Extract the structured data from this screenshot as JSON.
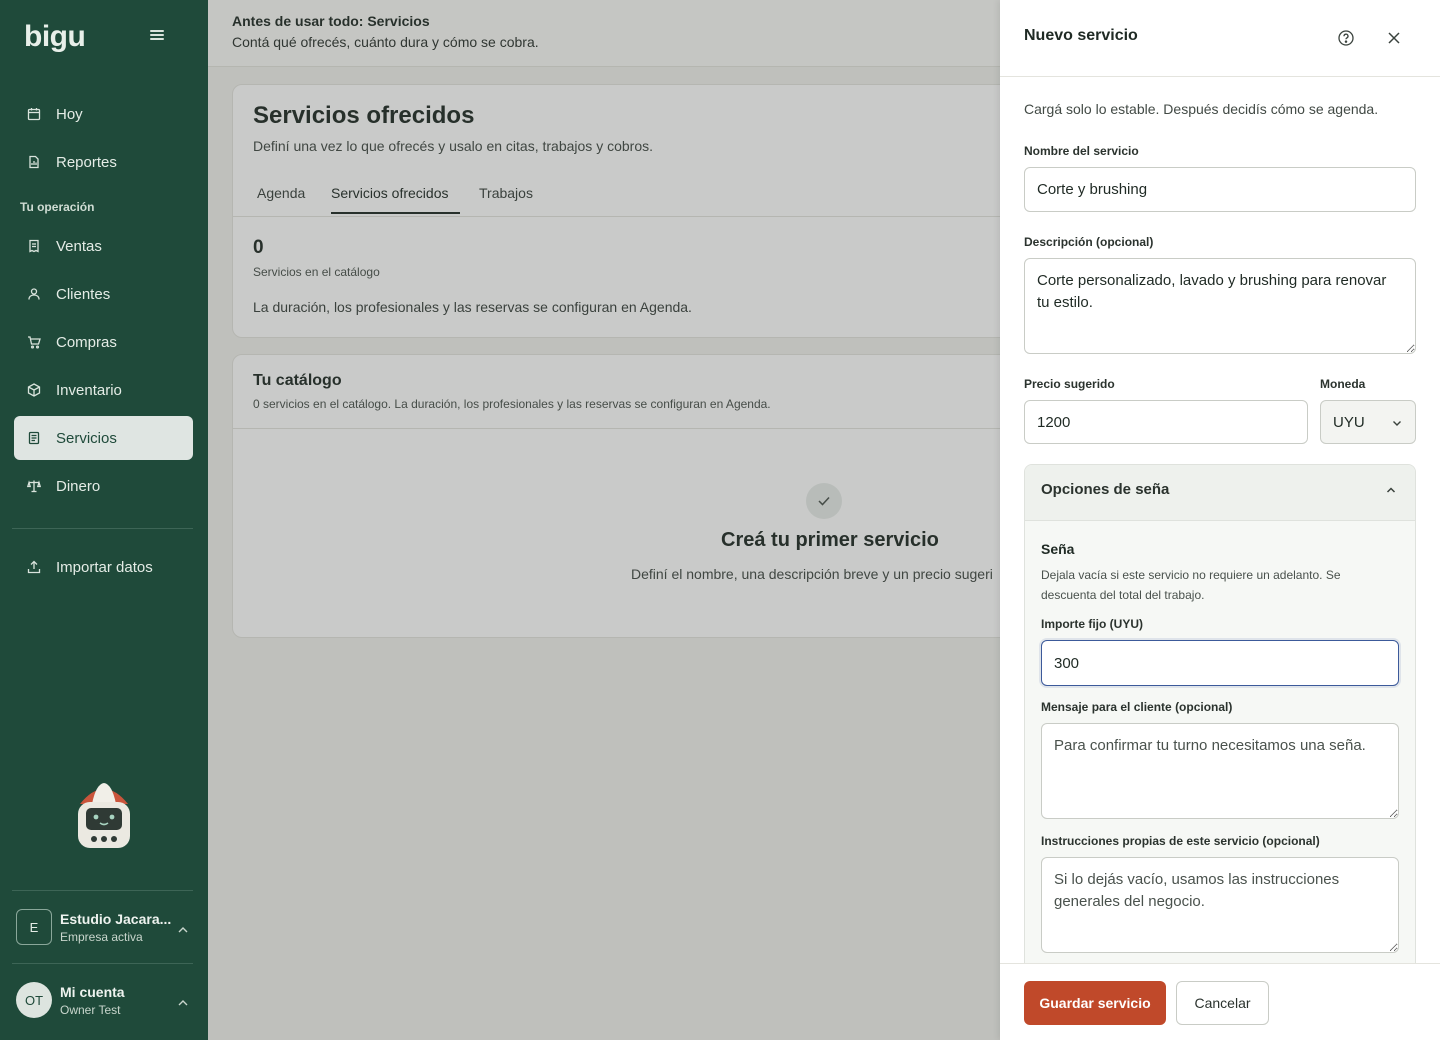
{
  "app": {
    "logo": "bigu"
  },
  "sidebar": {
    "items_top": [
      {
        "label": "Hoy",
        "icon": "calendar-icon"
      },
      {
        "label": "Reportes",
        "icon": "report-icon"
      }
    ],
    "section_label": "Tu operación",
    "items": [
      {
        "label": "Ventas",
        "icon": "receipt-icon"
      },
      {
        "label": "Clientes",
        "icon": "user-icon"
      },
      {
        "label": "Compras",
        "icon": "cart-icon"
      },
      {
        "label": "Inventario",
        "icon": "box-icon"
      },
      {
        "label": "Servicios",
        "icon": "document-icon",
        "active": true
      },
      {
        "label": "Dinero",
        "icon": "scale-icon"
      }
    ],
    "import_label": "Importar datos",
    "company": {
      "initial": "E",
      "name": "Estudio Jacara...",
      "status": "Empresa activa"
    },
    "account": {
      "initials": "OT",
      "name": "Mi cuenta",
      "role": "Owner Test"
    }
  },
  "banner": {
    "title": "Antes de usar todo: Servicios",
    "subtitle": "Contá qué ofrecés, cuánto dura y cómo se cobra."
  },
  "main": {
    "title": "Servicios ofrecidos",
    "subtitle": "Definí una vez lo que ofrecés y usalo en citas, trabajos y cobros.",
    "tabs": [
      {
        "label": "Agenda"
      },
      {
        "label": "Servicios ofrecidos",
        "active": true
      },
      {
        "label": "Trabajos"
      }
    ],
    "stat_value": "0",
    "stat_label": "Servicios en el catálogo",
    "note": "La duración, los profesionales y las reservas se configuran en Agenda.",
    "catalog": {
      "title": "Tu catálogo",
      "subtitle": "0 servicios en el catálogo. La duración, los profesionales y las reservas se configuran en Agenda.",
      "empty_title": "Creá tu primer servicio",
      "empty_sub": "Definí el nombre, una descripción breve y un precio sugeri"
    }
  },
  "drawer": {
    "title": "Nuevo servicio",
    "intro": "Cargá solo lo estable. Después decidís cómo se agenda.",
    "name_label": "Nombre del servicio",
    "name_value": "Corte y brushing",
    "desc_label": "Descripción (opcional)",
    "desc_value": "Corte personalizado, lavado y brushing para renovar tu estilo.",
    "price_label": "Precio sugerido",
    "price_value": "1200",
    "currency_label": "Moneda",
    "currency_value": "UYU",
    "deposit_accordion": {
      "title": "Opciones de seña",
      "section_title": "Seña",
      "help": "Dejala vacía si este servicio no requiere un adelanto. Se descuenta del total del trabajo.",
      "amount_label": "Importe fijo (UYU)",
      "amount_value": "300",
      "message_label": "Mensaje para el cliente (opcional)",
      "message_placeholder": "Para confirmar tu turno necesitamos una seña.",
      "instructions_label": "Instrucciones propias de este servicio (opcional)",
      "instructions_placeholder": "Si lo dejás vacío, usamos las instrucciones generales del negocio."
    },
    "save_label": "Guardar servicio",
    "cancel_label": "Cancelar"
  }
}
